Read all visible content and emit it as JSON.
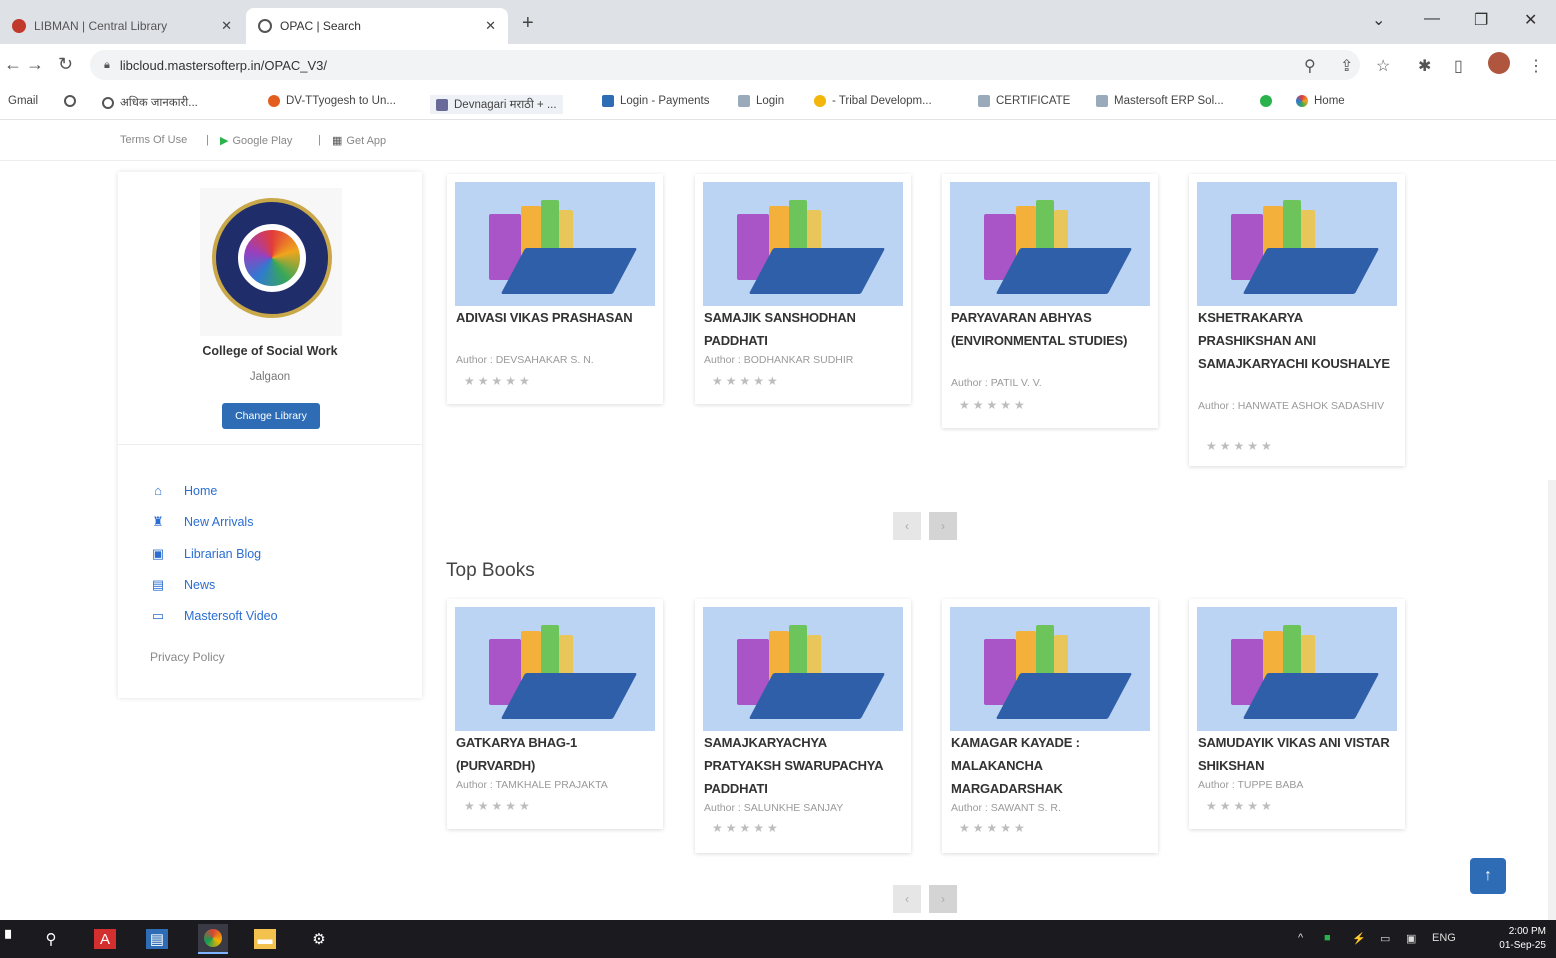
{
  "browser": {
    "tabs": [
      {
        "title": "LIBMAN | Central Library",
        "active": false
      },
      {
        "title": "OPAC | Search",
        "active": true
      }
    ],
    "url": "libcloud.mastersofterp.in/OPAC_V3/",
    "bookmarks": [
      "Gmail",
      "अधिक जानकारी...",
      "DV-TTyogesh to Un...",
      "Devnagari मराठी + ...",
      "Login - Payments",
      "Login",
      "- Tribal Developm...",
      "CERTIFICATE",
      "Mastersoft ERP Sol...",
      "Home"
    ]
  },
  "site_top": {
    "terms": "Terms Of Use",
    "sep": "|",
    "play": "Google Play",
    "app": "Get App"
  },
  "sidebar": {
    "college": "College of Social Work",
    "city": "Jalgaon",
    "change_label": "Change Library",
    "nav": [
      "Home",
      "New Arrivals",
      "Librarian Blog",
      "News",
      "Mastersoft Video"
    ],
    "privacy": "Privacy Policy"
  },
  "new_books": [
    {
      "title": "ADIVASI VIKAS PRASHASAN",
      "author": "Author : DEVSAHAKAR S. N."
    },
    {
      "title": "SAMAJIK SANSHODHAN PADDHATI",
      "author": "Author : BODHANKAR SUDHIR"
    },
    {
      "title": "PARYAVARAN ABHYAS (ENVIRONMENTAL STUDIES)",
      "author": "Author : PATIL V. V."
    },
    {
      "title": "KSHETRAKARYA PRASHIKSHAN ANI SAMAJKARYACHI KOUSHALYE",
      "author": "Author : HANWATE ASHOK SADASHIV"
    }
  ],
  "top_books_heading": "Top Books",
  "top_books": [
    {
      "title": "GATKARYA BHAG-1 (PURVARDH)",
      "author": "Author : TAMKHALE PRAJAKTA"
    },
    {
      "title": "SAMAJKARYACHYA PRATYAKSH SWARUPACHYA PADDHATI",
      "author": "Author : SALUNKHE SANJAY"
    },
    {
      "title": "KAMAGAR KAYADE : MALAKANCHA MARGADARSHAK",
      "author": "Author : SAWANT S. R."
    },
    {
      "title": "SAMUDAYIK VIKAS ANI VISTAR SHIKSHAN",
      "author": "Author : TUPPE BABA"
    }
  ],
  "stars": "★★★★★",
  "taskbar": {
    "time": "2:00 PM",
    "date": "01-Sep-25",
    "lang": "ENG"
  }
}
